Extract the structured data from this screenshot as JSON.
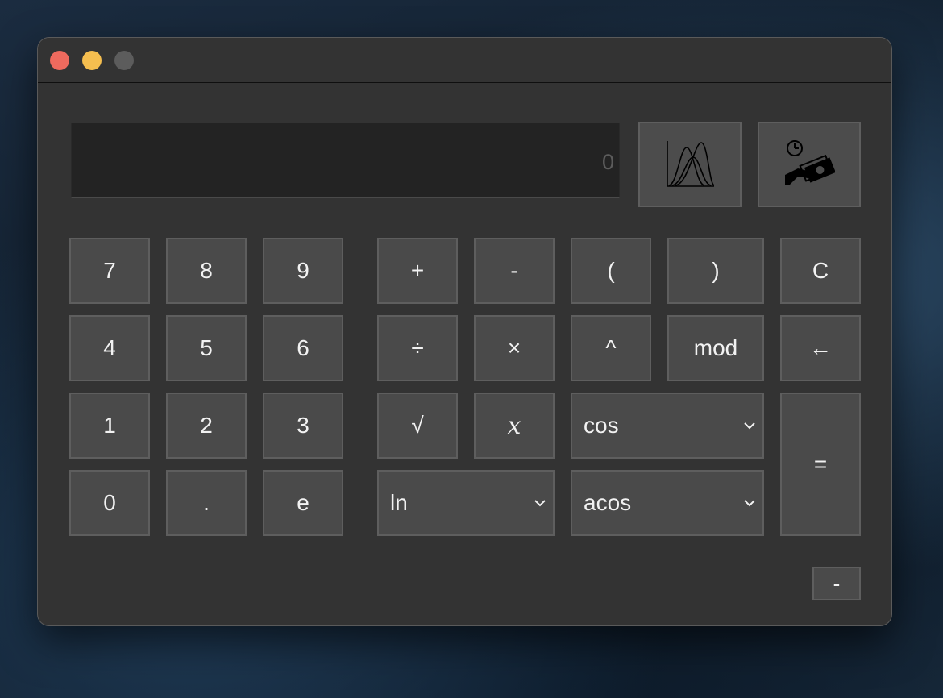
{
  "window": {
    "title": ""
  },
  "display": {
    "value": "0"
  },
  "tools": {
    "distribution_icon": "distribution-chart-icon",
    "finance_icon": "money-time-icon"
  },
  "digits": {
    "seven": "7",
    "eight": "8",
    "nine": "9",
    "four": "4",
    "five": "5",
    "six": "6",
    "one": "1",
    "two": "2",
    "three": "3",
    "zero": "0",
    "dot": ".",
    "e": "e"
  },
  "ops": {
    "plus": "+",
    "minus": "-",
    "lparen": "(",
    "rparen": ")",
    "clear": "C",
    "divide": "÷",
    "multiply": "×",
    "power": "^",
    "mod": "mod",
    "backspace": "←",
    "sqrt": "√",
    "x": "x",
    "equals": "="
  },
  "selects": {
    "trig": "cos",
    "log": "ln",
    "inverse_trig": "acos"
  },
  "footer": {
    "collapse": "-"
  },
  "colors": {
    "close": "#ee6a5e",
    "minimize": "#f5be4f",
    "maximize": "#5c5c5c",
    "button": "#4a4a4a",
    "window": "#333333"
  }
}
